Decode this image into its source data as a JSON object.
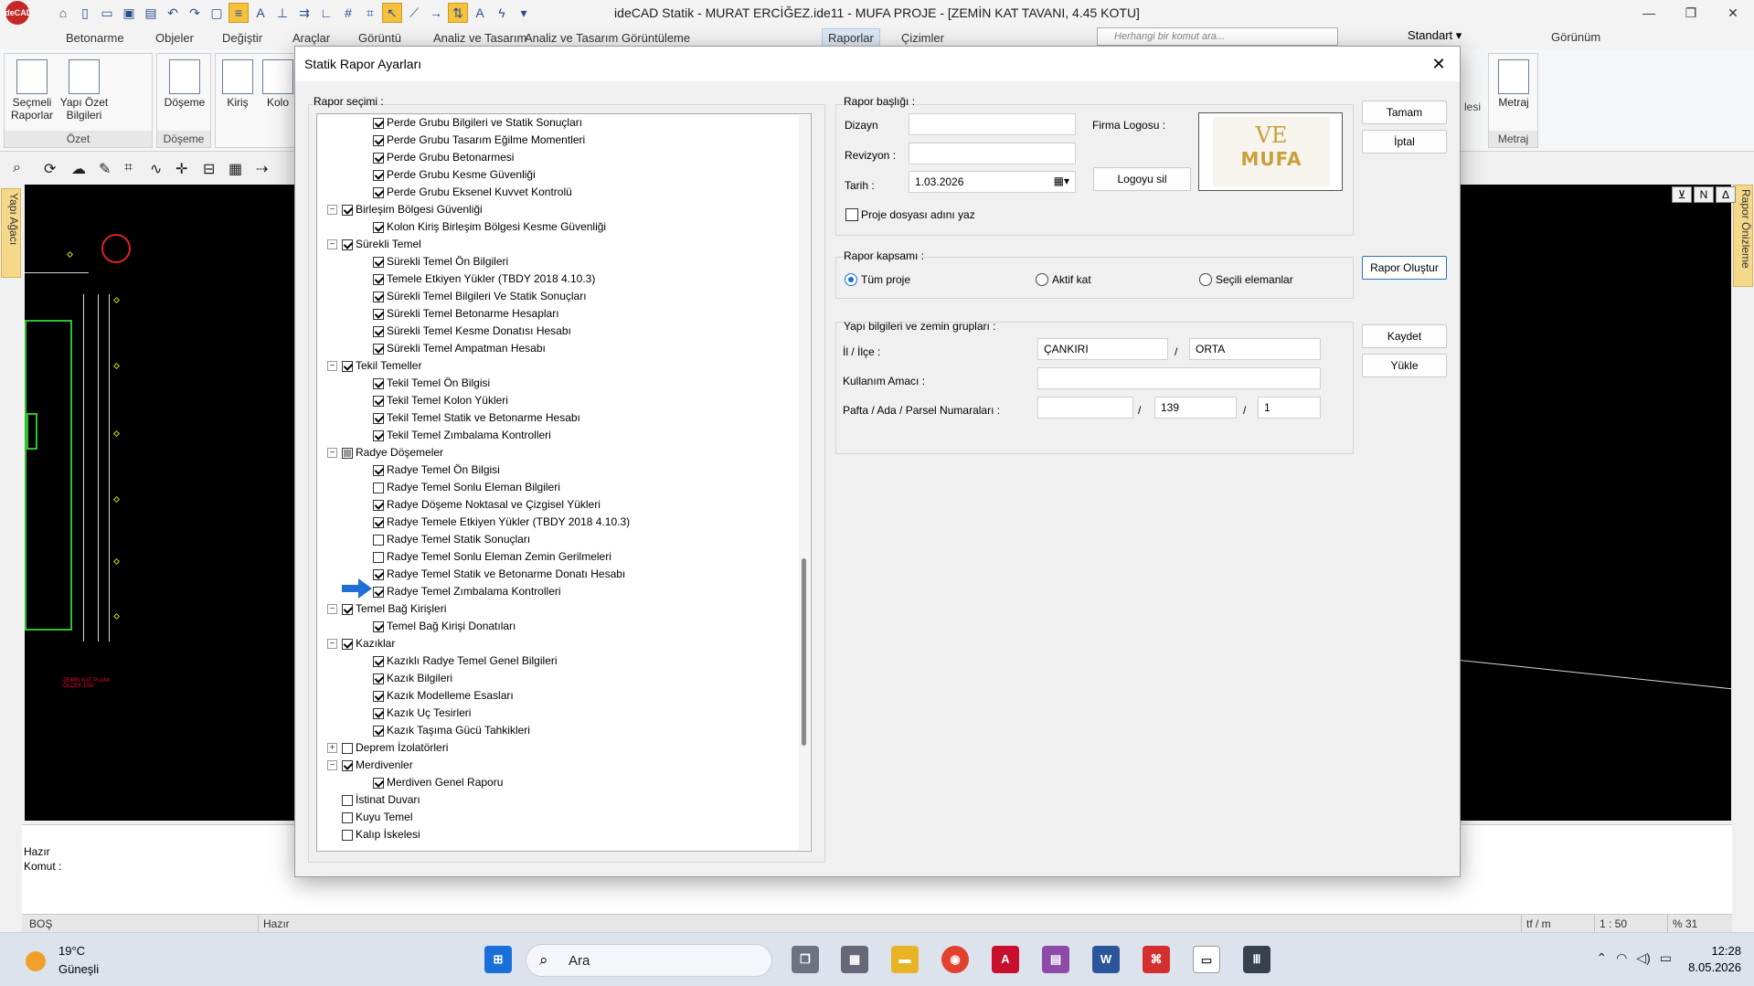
{
  "app": {
    "title": "ideCAD Statik - MURAT ERCİĞEZ.ide11 - MUFA PROJE  - [ZEMİN KAT TAVANI,  4.45 KOTU]",
    "logo_text": "ideCAD",
    "menu_tabs": [
      "Betonarme",
      "Objeler",
      "Değiştir",
      "Araçlar",
      "Görüntü",
      "Analiz ve Tasarım",
      "Analiz ve Tasarım Görüntüleme",
      "Raporlar",
      "Çizimler"
    ],
    "command_search_placeholder": "Herhangi bir komut ara...",
    "style_combo": "Standart",
    "view_label": "Görünüm"
  },
  "ribbon": {
    "groups": [
      {
        "name": "Özet",
        "buttons": [
          "Seçmeli Raporlar",
          "Yapı Özet Bilgileri"
        ]
      },
      {
        "name": "Döşeme",
        "buttons": [
          "Döşeme"
        ]
      },
      {
        "name": "",
        "buttons": [
          "Kiriş",
          "Kolo"
        ]
      },
      {
        "name": "Metraj",
        "buttons": [
          "Metraj"
        ]
      }
    ],
    "partial_label": "lesi"
  },
  "side": {
    "left_tab": "Yapı Ağacı",
    "right_tab": "Rapor Önizleme"
  },
  "canvas": {
    "caption_line1": "ZEMİN KAT PLANI",
    "caption_line2": "ÖLÇEK 1/50"
  },
  "command": {
    "line1": "Hazır",
    "line2": "Komut :"
  },
  "statusbar": {
    "left": "BOŞ",
    "msg": "Hazır",
    "unit": "tf / m",
    "scale": "1 : 50",
    "zoom": "% 31"
  },
  "taskbar": {
    "temp": "19°C",
    "weather": "Güneşli",
    "search": "Ara",
    "time": "12:28",
    "date": "8.05.2026"
  },
  "dialog": {
    "title": "Statik Rapor Ayarları",
    "tree_label": "Rapor seçimi :",
    "tree": [
      {
        "level": 2,
        "state": "on",
        "label": "Perde Grubu Bilgileri ve Statik Sonuçları"
      },
      {
        "level": 2,
        "state": "on",
        "label": "Perde Grubu Tasarım Eğilme Momentleri"
      },
      {
        "level": 2,
        "state": "on",
        "label": "Perde Grubu Betonarmesi"
      },
      {
        "level": 2,
        "state": "on",
        "label": "Perde Grubu Kesme Güvenliği"
      },
      {
        "level": 2,
        "state": "on",
        "label": "Perde Grubu Eksenel Kuvvet Kontrolü"
      },
      {
        "level": 1,
        "state": "on",
        "expander": "−",
        "label": "Birleşim Bölgesi Güvenliği"
      },
      {
        "level": 2,
        "state": "on",
        "label": "Kolon Kiriş Birleşim Bölgesi Kesme Güvenliği"
      },
      {
        "level": 1,
        "state": "on",
        "expander": "−",
        "label": "Sürekli Temel"
      },
      {
        "level": 2,
        "state": "on",
        "label": "Sürekli Temel Ön Bilgileri"
      },
      {
        "level": 2,
        "state": "on",
        "label": "Temele Etkiyen Yükler (TBDY 2018 4.10.3)"
      },
      {
        "level": 2,
        "state": "on",
        "label": "Sürekli Temel Bilgileri Ve Statik Sonuçları"
      },
      {
        "level": 2,
        "state": "on",
        "label": "Sürekli Temel Betonarme Hesapları"
      },
      {
        "level": 2,
        "state": "on",
        "label": "Sürekli Temel Kesme Donatısı Hesabı"
      },
      {
        "level": 2,
        "state": "on",
        "label": "Sürekli Temel Ampatman Hesabı"
      },
      {
        "level": 1,
        "state": "on",
        "expander": "−",
        "label": "Tekil Temeller"
      },
      {
        "level": 2,
        "state": "on",
        "label": "Tekil Temel Ön Bilgisi"
      },
      {
        "level": 2,
        "state": "on",
        "label": "Tekil Temel Kolon Yükleri"
      },
      {
        "level": 2,
        "state": "on",
        "label": "Tekil Temel Statik ve Betonarme Hesabı"
      },
      {
        "level": 2,
        "state": "on",
        "label": "Tekil Temel Zımbalama Kontrolleri"
      },
      {
        "level": 1,
        "state": "part",
        "expander": "−",
        "label": "Radye Döşemeler"
      },
      {
        "level": 2,
        "state": "on",
        "label": "Radye Temel Ön Bilgisi"
      },
      {
        "level": 2,
        "state": "off",
        "label": "Radye Temel Sonlu Eleman Bilgileri"
      },
      {
        "level": 2,
        "state": "on",
        "label": "Radye Döşeme Noktasal ve Çizgisel Yükleri"
      },
      {
        "level": 2,
        "state": "on",
        "label": "Radye Temele Etkiyen Yükler (TBDY 2018 4.10.3)"
      },
      {
        "level": 2,
        "state": "off",
        "label": "Radye Temel Statik Sonuçları"
      },
      {
        "level": 2,
        "state": "off",
        "label": "Radye Temel Sonlu Eleman Zemin Gerilmeleri"
      },
      {
        "level": 2,
        "state": "on",
        "label": "Radye Temel Statik ve Betonarme Donatı Hesabı"
      },
      {
        "level": 2,
        "state": "on",
        "label": "Radye Temel Zımbalama Kontrolleri"
      },
      {
        "level": 1,
        "state": "on",
        "expander": "−",
        "label": "Temel Bağ Kirişleri"
      },
      {
        "level": 2,
        "state": "on",
        "label": "Temel Bağ Kirişi Donatıları"
      },
      {
        "level": 1,
        "state": "on",
        "expander": "−",
        "label": "Kazıklar"
      },
      {
        "level": 2,
        "state": "on",
        "label": "Kazıklı Radye Temel Genel Bilgileri"
      },
      {
        "level": 2,
        "state": "on",
        "label": "Kazık Bilgileri"
      },
      {
        "level": 2,
        "state": "on",
        "label": "Kazık Modelleme Esasları"
      },
      {
        "level": 2,
        "state": "on",
        "label": "Kazık Uç Tesirleri"
      },
      {
        "level": 2,
        "state": "on",
        "label": "Kazık Taşıma Gücü Tahkikleri"
      },
      {
        "level": 1,
        "state": "off",
        "expander": "+",
        "label": "Deprem İzolatörleri"
      },
      {
        "level": 1,
        "state": "on",
        "expander": "−",
        "label": "Merdivenler"
      },
      {
        "level": 2,
        "state": "on",
        "label": "Merdiven Genel Raporu"
      },
      {
        "level": 1,
        "state": "off",
        "label": "İstinat Duvarı"
      },
      {
        "level": 1,
        "state": "off",
        "label": "Kuyu Temel"
      },
      {
        "level": 1,
        "state": "off",
        "label": "Kalıp İskelesi"
      }
    ],
    "header": {
      "label": "Rapor başlığı :",
      "dizayn_label": "Dizayn",
      "dizayn_value": "",
      "revizyon_label": "Revizyon :",
      "revizyon_value": "",
      "tarih_label": "Tarih :",
      "tarih_value": "1.03.2026",
      "logo_label": "Firma Logosu :",
      "logo_delete": "Logoyu sil",
      "project_name_label": "Proje dosyası adını yaz",
      "project_name_checked": false,
      "logo_text_top": "VE",
      "logo_text_bottom": "MUFA"
    },
    "scope": {
      "label": "Rapor kapsamı :",
      "options": [
        "Tüm proje",
        "Aktif kat",
        "Seçili elemanlar"
      ],
      "selected": "Tüm proje"
    },
    "building": {
      "label": "Yapı bilgileri ve zemin grupları :",
      "il_ilce_label": "İl / İlçe :",
      "il": "ÇANKIRI",
      "ilce": "ORTA",
      "kullanim_label": "Kullanım Amacı :",
      "kullanim": "",
      "pafta_label": "Pafta / Ada / Parsel Numaraları :",
      "pafta": "",
      "ada": "139",
      "parsel": "1",
      "slash": "/"
    },
    "buttons": {
      "ok": "Tamam",
      "cancel": "İptal",
      "create": "Rapor Oluştur",
      "save": "Kaydet",
      "load": "Yükle"
    }
  }
}
